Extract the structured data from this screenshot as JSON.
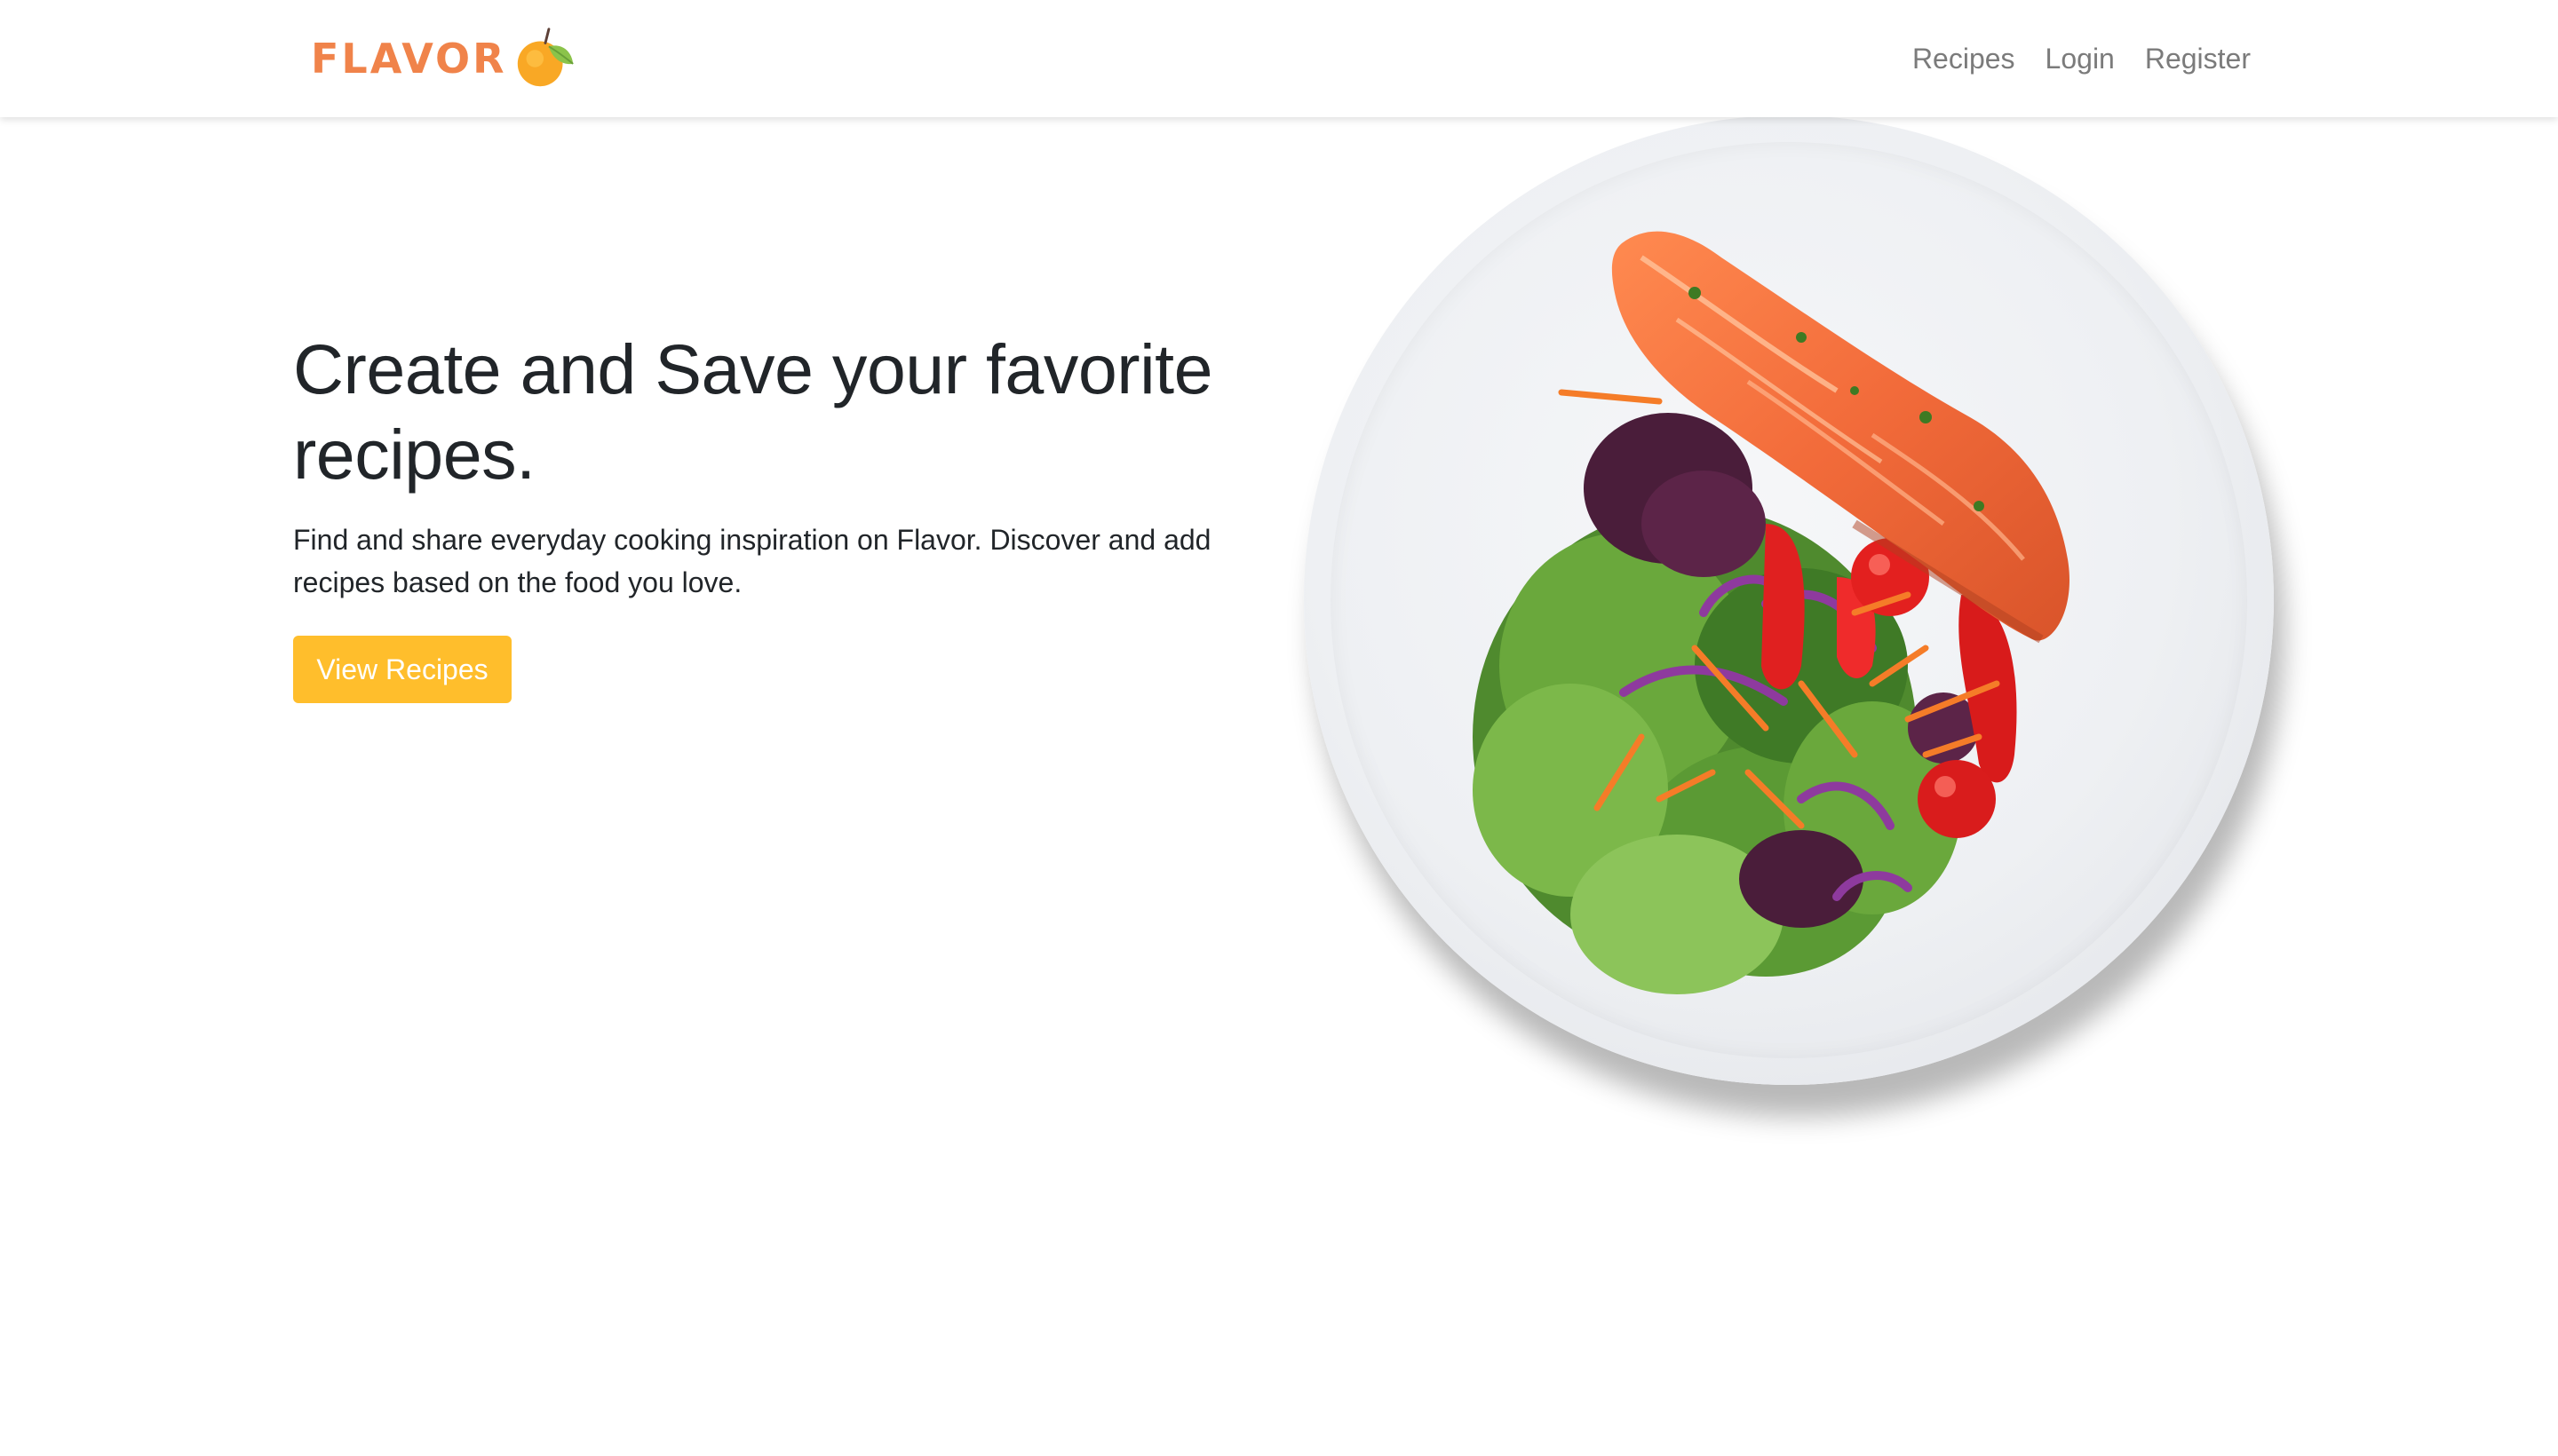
{
  "navbar": {
    "brand": "FLAVOR",
    "brand_color": "#f0834a",
    "logo_icon": "orange-fruit-icon",
    "links": [
      {
        "label": "Recipes"
      },
      {
        "label": "Login"
      },
      {
        "label": "Register"
      }
    ]
  },
  "hero": {
    "title": "Create and Save your favorite recipes.",
    "lead": "Find and share everyday cooking inspiration on Flavor. Discover and add recipes based on the food you love.",
    "button_label": "View Recipes",
    "button_color": "#ffbe2c"
  },
  "image": {
    "subject": "salmon-salad-plate-image"
  }
}
